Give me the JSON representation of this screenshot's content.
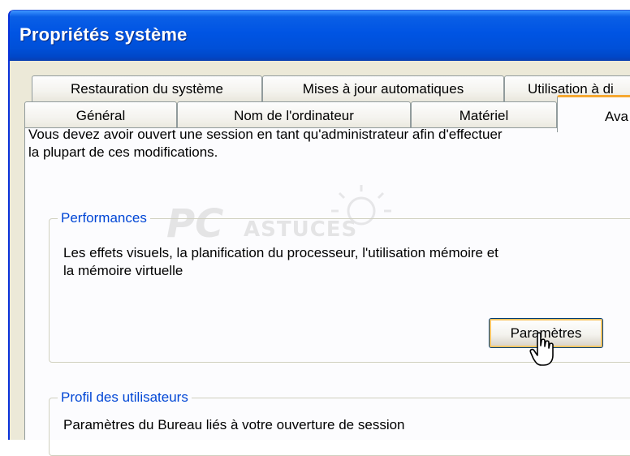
{
  "window": {
    "title": "Propriétés système"
  },
  "tabs": {
    "row1": [
      {
        "label": "Restauration du système"
      },
      {
        "label": "Mises à jour automatiques"
      },
      {
        "label": "Utilisation à di"
      }
    ],
    "row2": [
      {
        "label": "Général"
      },
      {
        "label": "Nom de l'ordinateur"
      },
      {
        "label": "Matériel"
      },
      {
        "label": "Ava",
        "active": true
      }
    ]
  },
  "panel": {
    "intro_line1": "Vous devez avoir ouvert une session en tant qu'administrateur afin d'effectuer",
    "intro_line2": "la plupart de ces modifications.",
    "performance": {
      "legend": "Performances",
      "description_line1": "Les effets visuels, la planification du processeur, l'utilisation mémoire et",
      "description_line2": "la mémoire virtuelle",
      "button_label": "Paramètres"
    },
    "user_profiles": {
      "legend": "Profil des utilisateurs",
      "description": "Paramètres du Bureau liés à votre ouverture de session"
    }
  },
  "watermark": {
    "part1": "PC",
    "part2": "ASTUCES"
  },
  "colors": {
    "titlebar": "#0054e3",
    "groupbox_legend": "#0046d5",
    "active_tab_accent": "#f6a831",
    "dialog_background": "#ece9d8",
    "tab_panel": "#fcfcfe"
  }
}
